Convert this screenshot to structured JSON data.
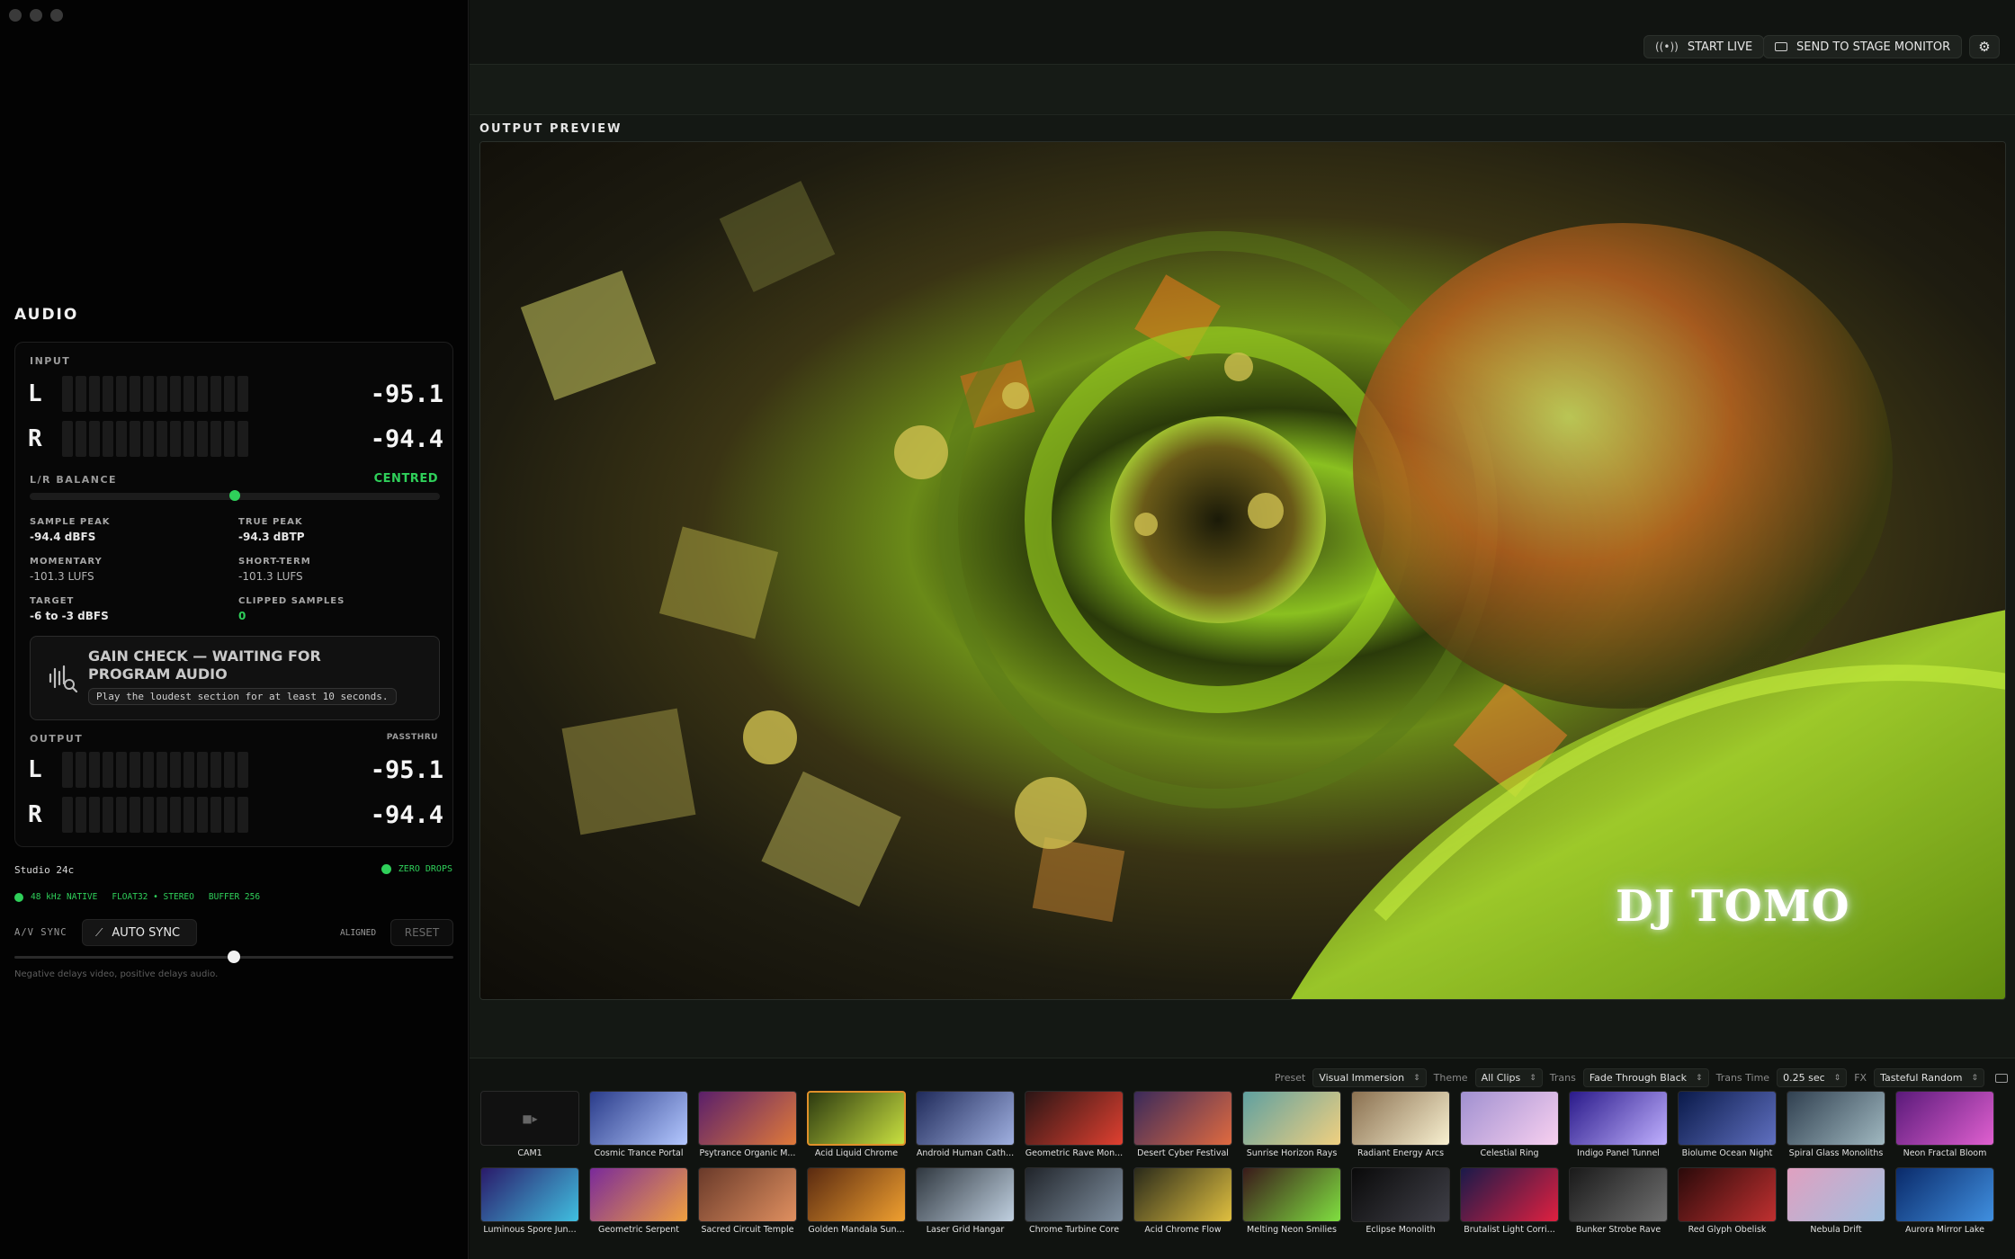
{
  "audio": {
    "title": "AUDIO",
    "input_label": "INPUT",
    "input": [
      {
        "channel": "L",
        "value": "-95.1"
      },
      {
        "channel": "R",
        "value": "-94.4"
      }
    ],
    "balance_label": "L/R BALANCE",
    "balance_status": "CENTRED",
    "stats": {
      "sample_peak_label": "SAMPLE PEAK",
      "sample_peak": "-94.4 dBFS",
      "true_peak_label": "TRUE PEAK",
      "true_peak": "-94.3 dBTP",
      "momentary_label": "MOMENTARY",
      "momentary": "-101.3 LUFS",
      "short_term_label": "SHORT-TERM",
      "short_term": "-101.3 LUFS",
      "target_label": "TARGET",
      "target": "-6 to -3 dBFS",
      "clipped_label": "CLIPPED SAMPLES",
      "clipped": "0"
    },
    "gain_check_title": "GAIN CHECK — WAITING FOR PROGRAM AUDIO",
    "gain_check_hint": "Play the loudest section for at least 10 seconds.",
    "output_label": "OUTPUT",
    "output_mode": "PASSTHRU",
    "output": [
      {
        "channel": "L",
        "value": "-95.1"
      },
      {
        "channel": "R",
        "value": "-94.4"
      }
    ],
    "device": "Studio 24c",
    "drops_status": "ZERO DROPS",
    "format_rate": "48 kHz NATIVE",
    "format_type": "FLOAT32 • STEREO",
    "format_buffer": "BUFFER 256",
    "av_sync_label": "A/V SYNC",
    "auto_sync_label": "AUTO SYNC",
    "aligned_label": "ALIGNED",
    "reset_label": "RESET",
    "sync_position": 0.5,
    "sync_hint": "Negative delays video, positive delays audio."
  },
  "topbar": {
    "start_live": "START LIVE",
    "send_to_stage": "SEND TO STAGE MONITOR"
  },
  "preview": {
    "label": "OUTPUT PREVIEW",
    "overlay_text": "DJ TOMO"
  },
  "controls": {
    "preset_label": "Preset",
    "preset": "Visual Immersion",
    "theme_label": "Theme",
    "theme": "All Clips",
    "trans_label": "Trans",
    "trans": "Fade Through Black",
    "trans_time_label": "Trans Time",
    "trans_time": "0.25 sec",
    "fx_label": "FX",
    "fx": "Tasteful Random"
  },
  "clips": [
    {
      "name": "CAM1",
      "colors": [
        "#111111",
        "#111111"
      ],
      "camera": true
    },
    {
      "name": "Cosmic Trance Portal",
      "colors": [
        "#2a3c8a",
        "#b4c8ff"
      ]
    },
    {
      "name": "Psytrance Organic M...",
      "colors": [
        "#5a1f6a",
        "#e07a3a"
      ]
    },
    {
      "name": "Acid Liquid Chrome",
      "colors": [
        "#2d3a10",
        "#c8e040"
      ],
      "active": true
    },
    {
      "name": "Android Human Cath...",
      "colors": [
        "#1f2a5a",
        "#a0b0e0"
      ]
    },
    {
      "name": "Geometric Rave Mon...",
      "colors": [
        "#2a1515",
        "#e04030"
      ]
    },
    {
      "name": "Desert Cyber Festival",
      "colors": [
        "#3a2a5a",
        "#e06a40"
      ]
    },
    {
      "name": "Sunrise Horizon Rays",
      "colors": [
        "#5fa0a0",
        "#f0d080"
      ]
    },
    {
      "name": "Radiant Energy Arcs",
      "colors": [
        "#8a7050",
        "#f8f0d0"
      ]
    },
    {
      "name": "Celestial Ring",
      "colors": [
        "#a090d0",
        "#f8d0f0"
      ]
    },
    {
      "name": "Indigo Panel Tunnel",
      "colors": [
        "#2a1a8a",
        "#c0b0ff"
      ]
    },
    {
      "name": "Biolume Ocean Night",
      "colors": [
        "#0a1a4a",
        "#6070c0"
      ]
    },
    {
      "name": "Spiral Glass Monoliths",
      "colors": [
        "#304050",
        "#a0b8c0"
      ]
    },
    {
      "name": "Neon Fractal Bloom",
      "colors": [
        "#5a1a7a",
        "#e060d0"
      ]
    },
    {
      "name": "Luminous Spore Jun...",
      "colors": [
        "#2a1a6a",
        "#40c0e0"
      ]
    },
    {
      "name": "Geometric Serpent",
      "colors": [
        "#7a2a9a",
        "#f0a040"
      ]
    },
    {
      "name": "Sacred Circuit Temple",
      "colors": [
        "#6a3a2a",
        "#e09060"
      ]
    },
    {
      "name": "Golden Mandala Sun...",
      "colors": [
        "#5a2a10",
        "#f0a030"
      ]
    },
    {
      "name": "Laser Grid Hangar",
      "colors": [
        "#303840",
        "#c0d0e0"
      ]
    },
    {
      "name": "Chrome Turbine Core",
      "colors": [
        "#20242a",
        "#8090a0"
      ]
    },
    {
      "name": "Acid Chrome Flow",
      "colors": [
        "#2a2a1a",
        "#e0c040"
      ]
    },
    {
      "name": "Melting Neon Smilies",
      "colors": [
        "#3a1a1a",
        "#80e040"
      ]
    },
    {
      "name": "Eclipse Monolith",
      "colors": [
        "#0a0a0a",
        "#404048"
      ]
    },
    {
      "name": "Brutalist Light Corri...",
      "colors": [
        "#1a1a4a",
        "#e02040"
      ]
    },
    {
      "name": "Bunker Strobe Rave",
      "colors": [
        "#1a1a1a",
        "#707070"
      ]
    },
    {
      "name": "Red Glyph Obelisk",
      "colors": [
        "#2a0a0a",
        "#c03030"
      ]
    },
    {
      "name": "Nebula Drift",
      "colors": [
        "#e0a0c0",
        "#a0c0e0"
      ]
    },
    {
      "name": "Aurora Mirror Lake",
      "colors": [
        "#0a2a6a",
        "#4090e0"
      ]
    }
  ]
}
